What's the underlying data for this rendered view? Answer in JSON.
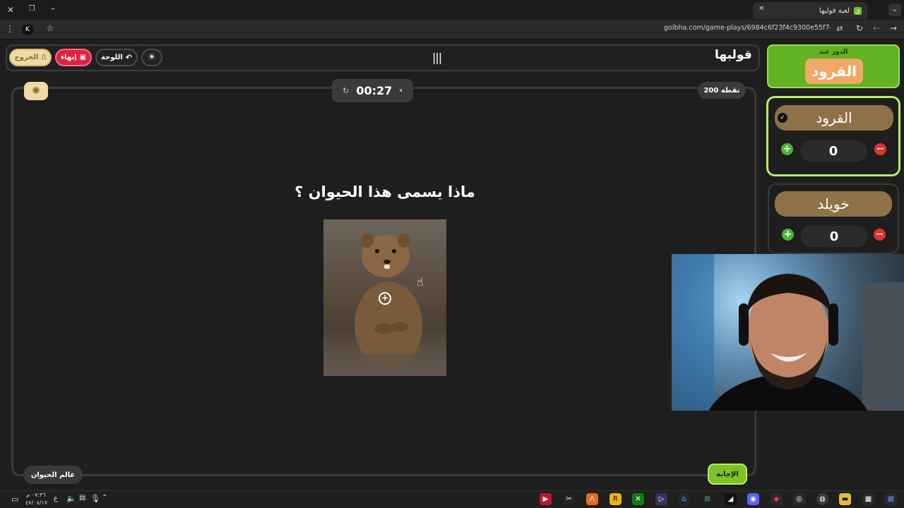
{
  "browser": {
    "tab_title": "لعبة قولبها",
    "url": "golbha.com/game-plays/6984c6f23f4c9300e55f7444",
    "profile_initial": "K"
  },
  "header": {
    "logo": "قولبها",
    "exit_label": "الخروج",
    "end_label": "إنهاء",
    "board_label": "اللوحة"
  },
  "game": {
    "timer": "00:27",
    "points": "200 نقطة",
    "question": "ماذا يسمى هذا الحيوان ؟",
    "category": "عالم الحيوان",
    "answer_label": "الإجابة"
  },
  "sidebar": {
    "turn_label": "الدور عند",
    "turn_team": "القرود",
    "teams": [
      {
        "name": "القرود",
        "score": "0"
      },
      {
        "name": "خويلد",
        "score": "0"
      }
    ]
  },
  "taskbar": {
    "time": "٠٧:٣٦ م",
    "date": "٤٧/٠٨/١٧",
    "lang": "ع"
  },
  "colors": {
    "accent_green": "#62b221",
    "end_red": "#e0213f",
    "exit_beige": "#efd9a5",
    "team_brown": "#8e7147"
  }
}
